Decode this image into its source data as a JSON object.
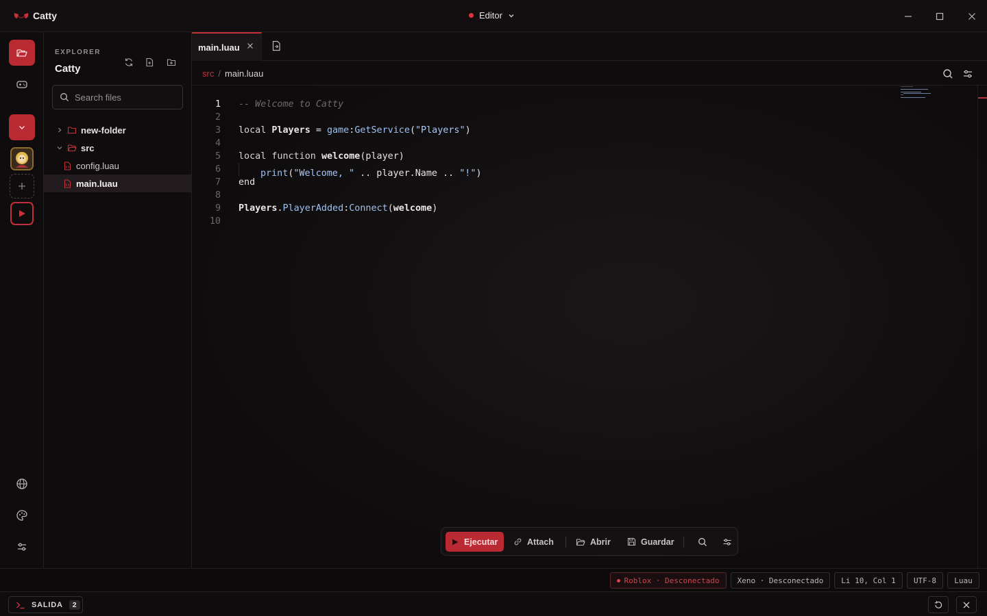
{
  "app": {
    "name": "Catty",
    "mode": "Editor"
  },
  "explorer": {
    "eyebrow": "EXPLORER",
    "title": "Catty",
    "search_placeholder": "Search files",
    "tree": [
      {
        "label": "new-folder",
        "type": "folder",
        "expanded": false
      },
      {
        "label": "src",
        "type": "folder",
        "expanded": true
      },
      {
        "label": "config.luau",
        "type": "file"
      },
      {
        "label": "main.luau",
        "type": "file",
        "selected": true
      }
    ]
  },
  "tabs": [
    {
      "label": "main.luau",
      "active": true
    }
  ],
  "breadcrumb": {
    "folder": "src",
    "separator": "/",
    "file": "main.luau"
  },
  "editor": {
    "line_numbers": [
      "1",
      "2",
      "3",
      "4",
      "5",
      "6",
      "7",
      "8",
      "9",
      "10"
    ],
    "active_line": "1",
    "lines": [
      "-- Welcome to Catty",
      "",
      "local Players = game:GetService(\"Players\")",
      "",
      "local function welcome(player)",
      "    print(\"Welcome, \" .. player.Name .. \"!\")",
      "end",
      "",
      "Players.PlayerAdded:Connect(welcome)",
      ""
    ]
  },
  "actions": {
    "run": "Ejecutar",
    "attach": "Attach",
    "open": "Abrir",
    "save": "Guardar"
  },
  "status": {
    "roblox": "Roblox · Desconectado",
    "xeno": "Xeno · Desconectado",
    "position": "Li 10, Col 1",
    "encoding": "UTF-8",
    "language": "Luau"
  },
  "output": {
    "label": "SALIDA",
    "count": "2"
  },
  "colors": {
    "accent": "#b92a32",
    "background": "#0d0b0c",
    "danger_text": "#d2454d"
  }
}
